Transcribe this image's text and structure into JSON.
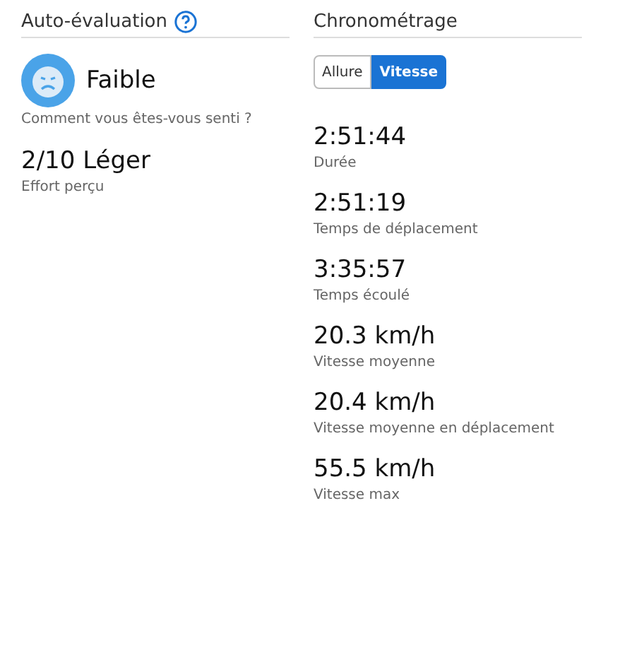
{
  "self_evaluation": {
    "title": "Auto-évaluation",
    "feeling": {
      "value": "Faible",
      "label": "Comment vous êtes-vous senti ?"
    },
    "effort": {
      "value": "2/10 Léger",
      "label": "Effort perçu"
    }
  },
  "timing": {
    "title": "Chronométrage",
    "toggle": [
      {
        "label": "Allure",
        "selected": false
      },
      {
        "label": "Vitesse",
        "selected": true
      }
    ],
    "stats": [
      {
        "value": "2:51:44",
        "label": "Durée"
      },
      {
        "value": "2:51:19",
        "label": "Temps de déplacement"
      },
      {
        "value": "3:35:57",
        "label": "Temps écoulé"
      },
      {
        "value": "20.3 km/h",
        "label": "Vitesse moyenne"
      },
      {
        "value": "20.4 km/h",
        "label": "Vitesse moyenne en déplacement"
      },
      {
        "value": "55.5 km/h",
        "label": "Vitesse max"
      }
    ]
  }
}
